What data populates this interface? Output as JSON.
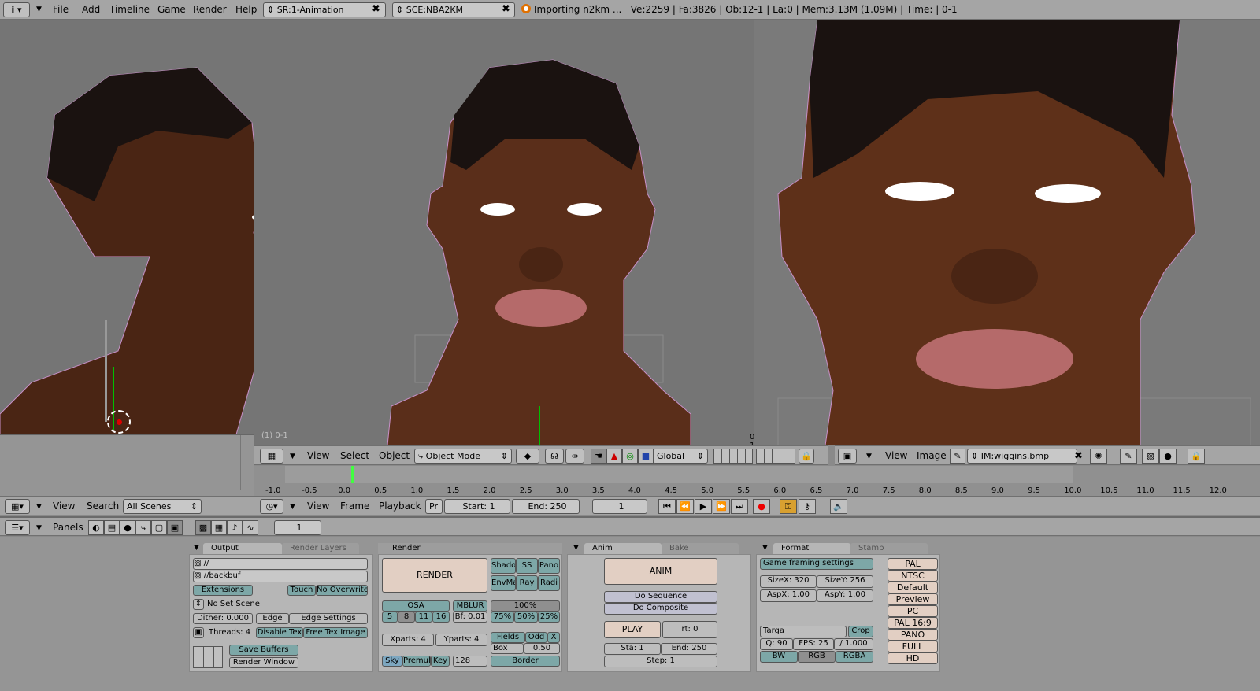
{
  "top_header": {
    "menus": [
      "File",
      "Add",
      "Timeline",
      "Game",
      "Render",
      "Help"
    ],
    "screen_field": "SR:1-Animation",
    "scene_field": "SCE:NBA2KM",
    "status": "Importing n2km ...   Ve:2259 | Fa:3826 | Ob:12-1 | La:0 | Mem:3.13M (1.09M) | Time: | 0-1"
  },
  "viewport": {
    "overlay_label": "0-1",
    "overlay_label_left": "(1) 0-1"
  },
  "view3d_header": {
    "menus": [
      "View",
      "Select",
      "Object"
    ],
    "mode": "Object Mode",
    "orientation": "Global"
  },
  "image_header": {
    "menus": [
      "View",
      "Image"
    ],
    "image_name": "IM:wiggins.bmp"
  },
  "outliner_header": {
    "menus": [
      "View",
      "Search"
    ],
    "scenes": "All Scenes"
  },
  "timeline": {
    "ticks": [
      "-1.0",
      "-0.5",
      "0.0",
      "0.5",
      "1.0",
      "1.5",
      "2.0",
      "2.5",
      "3.0",
      "3.5",
      "4.0",
      "4.5",
      "5.0",
      "5.5",
      "6.0",
      "6.5",
      "7.0",
      "7.5",
      "8.0",
      "8.5",
      "9.0",
      "9.5",
      "10.0",
      "10.5",
      "11.0",
      "11.5",
      "12.0"
    ],
    "menus": [
      "View",
      "Frame",
      "Playback"
    ],
    "pr_label": "Pr",
    "start": "Start: 1",
    "end": "End: 250",
    "current": "1"
  },
  "buttons_header": {
    "panels_label": "Panels",
    "frame": "1"
  },
  "output_panel": {
    "tab_active": "Output",
    "tab_inactive": "Render Layers",
    "path1": "//",
    "path2": "//backbuf",
    "extensions": "Extensions",
    "touch": "Touch",
    "no_overwrite": "No Overwrite",
    "no_set_scene": "No Set Scene",
    "dither": "Dither: 0.000",
    "edge": "Edge",
    "edge_settings": "Edge Settings",
    "threads": "Threads: 4",
    "disable_tex": "Disable Tex",
    "free_tex": "Free Tex Image",
    "save_buffers": "Save Buffers",
    "render_window": "Render Window"
  },
  "render_panel": {
    "title": "Render",
    "render": "RENDER",
    "shado": "Shado",
    "ss": "SS",
    "pano": "Pano",
    "envma": "EnvMa",
    "ray": "Ray",
    "radi": "Radi",
    "osa": "OSA",
    "osa_vals": [
      "5",
      "8",
      "11",
      "16"
    ],
    "mblur": "MBLUR",
    "bf": "Bf: 0.01",
    "pct100": "100%",
    "pct75": "75%",
    "pct50": "50%",
    "pct25": "25%",
    "xparts": "Xparts: 4",
    "yparts": "Yparts: 4",
    "fields": "Fields",
    "odd": "Odd",
    "x": "X",
    "box": "Box",
    "filter": "0.50",
    "sky": "Sky",
    "premul": "Premul",
    "key": "Key",
    "bits": "128",
    "border": "Border"
  },
  "anim_panel": {
    "tab_active": "Anim",
    "tab_inactive": "Bake",
    "anim": "ANIM",
    "do_sequence": "Do Sequence",
    "do_composite": "Do Composite",
    "play": "PLAY",
    "rt": "rt: 0",
    "sta": "Sta: 1",
    "end": "End: 250",
    "step": "Step: 1"
  },
  "format_panel": {
    "tab_active": "Format",
    "tab_inactive": "Stamp",
    "game_framing": "Game framing settings",
    "sizex": "SizeX: 320",
    "sizey": "SizeY: 256",
    "aspx": "AspX: 1.00",
    "aspy": "AspY: 1.00",
    "format": "Targa",
    "crop": "Crop",
    "q": "Q: 90",
    "fps": "FPS: 25",
    "fps_div": "/ 1.000",
    "bw": "BW",
    "rgb": "RGB",
    "rgba": "RGBA",
    "presets": [
      "PAL",
      "NTSC",
      "Default",
      "Preview",
      "PC",
      "PAL 16:9",
      "PANO",
      "FULL",
      "HD"
    ]
  },
  "colors": {
    "header": "#a5a5a5",
    "viewport": "#757575",
    "panel": "#b6b6b6",
    "skin": "#6b3a22",
    "render_button": "#e2cfc3"
  }
}
